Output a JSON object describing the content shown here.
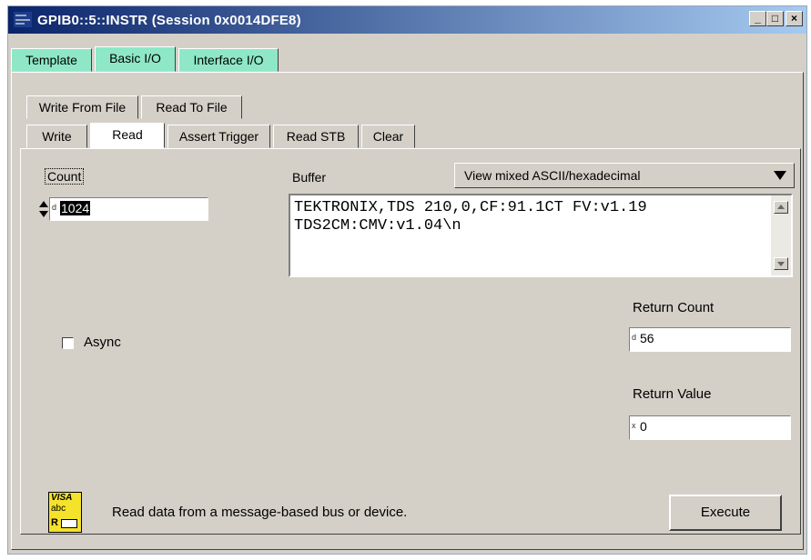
{
  "window": {
    "title": "GPIB0::5::INSTR (Session 0x0014DFE8)"
  },
  "window_buttons": {
    "minimize": "_",
    "maximize": "□",
    "close": "×"
  },
  "top_tabs": [
    "Template",
    "Basic I/O",
    "Interface I/O"
  ],
  "sub_tabs_back": [
    "Write From File",
    "Read To File"
  ],
  "sub_tabs_front": [
    "Write",
    "Read",
    "Assert Trigger",
    "Read STB",
    "Clear"
  ],
  "read": {
    "count_label": "Count",
    "count_value": "1024",
    "count_radix": "d",
    "buffer_label": "Buffer",
    "view_mode": "View mixed ASCII/hexadecimal",
    "buffer_text": "TEKTRONIX,TDS 210,0,CF:91.1CT FV:v1.19\nTDS2CM:CMV:v1.04\\n",
    "async_label": "Async",
    "return_count_label": "Return Count",
    "return_count_radix": "d",
    "return_count_value": "56",
    "return_value_label": "Return Value",
    "return_value_radix": "x",
    "return_value_value": "0",
    "description": "Read data from a message-based bus or device.",
    "execute_label": "Execute"
  },
  "visa_icon": {
    "line1": "VISA",
    "line2": "abc",
    "line3": "R"
  },
  "colors": {
    "titlebar_start": "#0a246a",
    "titlebar_end": "#a6caf0",
    "tab_green": "#8ee8c8",
    "face": "#d4d0c8"
  }
}
